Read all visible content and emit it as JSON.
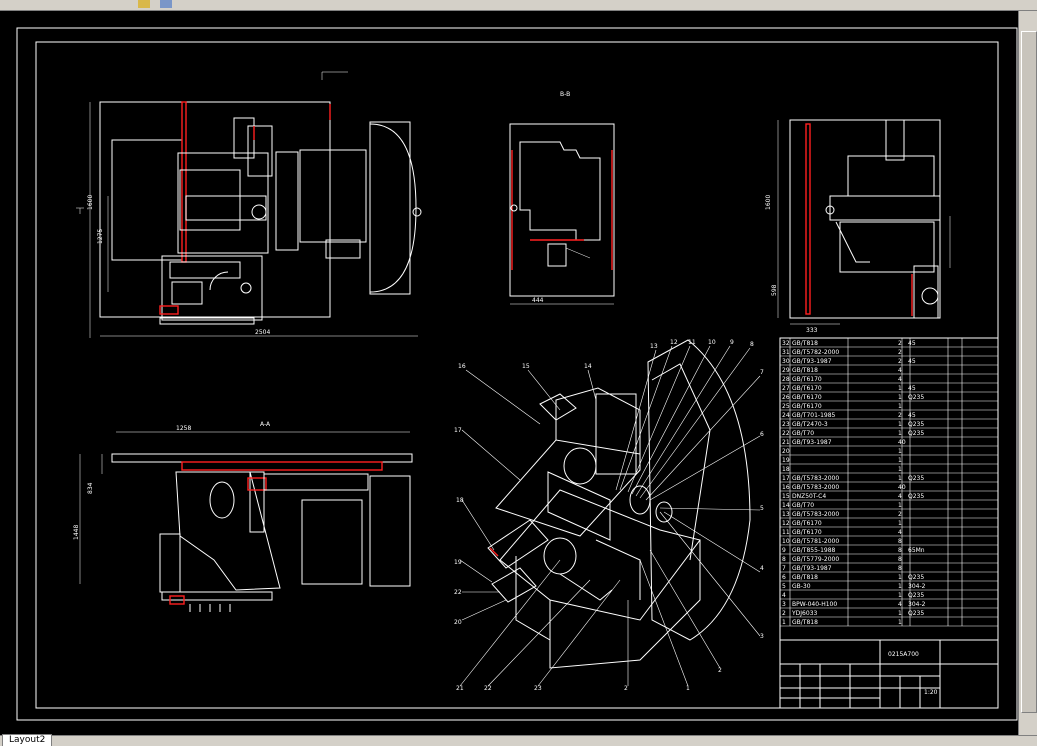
{
  "app": {
    "layout_tab_label": "Layout2"
  },
  "views": {
    "top_dim_width": "2504",
    "top_dim_height": "1600",
    "top_dim_inner": "1275",
    "section_b_label": "B-B",
    "section_b_dim": "444",
    "side_dim_a": "1600",
    "side_dim_b": "598",
    "side_dim_c": "333",
    "section_a_label": "A-A",
    "section_a_dim": "1258",
    "section_a_h1": "1448",
    "section_a_h2": "834"
  },
  "parts_list": {
    "rows": [
      {
        "no": "32",
        "code": "GB/T818",
        "qty": "2",
        "mat": "45"
      },
      {
        "no": "31",
        "code": "GB/T5782-2000",
        "qty": "2",
        "mat": ""
      },
      {
        "no": "30",
        "code": "GB/T93-1987",
        "qty": "2",
        "mat": "45"
      },
      {
        "no": "29",
        "code": "GB/T818",
        "qty": "4",
        "mat": ""
      },
      {
        "no": "28",
        "code": "GB/T6170",
        "qty": "4",
        "mat": ""
      },
      {
        "no": "27",
        "code": "GB/T6170",
        "qty": "1",
        "mat": "45"
      },
      {
        "no": "26",
        "code": "GB/T6170",
        "qty": "1",
        "mat": "Q235"
      },
      {
        "no": "25",
        "code": "GB/T6170",
        "qty": "1",
        "mat": ""
      },
      {
        "no": "24",
        "code": "GB/T701-1985",
        "qty": "2",
        "mat": "45"
      },
      {
        "no": "23",
        "code": "GB/T2470-3",
        "qty": "1",
        "mat": "Q235"
      },
      {
        "no": "22",
        "code": "GB/T70",
        "qty": "1",
        "mat": "Q235"
      },
      {
        "no": "21",
        "code": "GB/T93-1987",
        "qty": "40",
        "mat": ""
      },
      {
        "no": "20",
        "code": "",
        "qty": "1",
        "mat": ""
      },
      {
        "no": "19",
        "code": "",
        "qty": "1",
        "mat": ""
      },
      {
        "no": "18",
        "code": "",
        "qty": "1",
        "mat": ""
      },
      {
        "no": "17",
        "code": "GB/T5783-2000",
        "qty": "1",
        "mat": "Q235"
      },
      {
        "no": "16",
        "code": "GB/T5783-2000",
        "qty": "40",
        "mat": ""
      },
      {
        "no": "15",
        "code": "DNZ50T-C4",
        "qty": "4",
        "mat": "Q235"
      },
      {
        "no": "14",
        "code": "GB/T70",
        "qty": "1",
        "mat": ""
      },
      {
        "no": "13",
        "code": "GB/T5783-2000",
        "qty": "2",
        "mat": ""
      },
      {
        "no": "12",
        "code": "GB/T6170",
        "qty": "1",
        "mat": ""
      },
      {
        "no": "11",
        "code": "GB/T6170",
        "qty": "4",
        "mat": ""
      },
      {
        "no": "10",
        "code": "GB/T5781-2000",
        "qty": "8",
        "mat": ""
      },
      {
        "no": "9",
        "code": "GB/T855-1988",
        "qty": "8",
        "mat": "65Mn"
      },
      {
        "no": "8",
        "code": "GB/T5779-2000",
        "qty": "8",
        "mat": ""
      },
      {
        "no": "7",
        "code": "GB/T93-1987",
        "qty": "8",
        "mat": ""
      },
      {
        "no": "6",
        "code": "GB/T818",
        "qty": "1",
        "mat": "Q235"
      },
      {
        "no": "5",
        "code": "GB-30",
        "qty": "1",
        "mat": "304-2"
      },
      {
        "no": "4",
        "code": "",
        "qty": "1",
        "mat": "Q235"
      },
      {
        "no": "3",
        "code": "BPW-040-H100",
        "qty": "4",
        "mat": "304-2"
      },
      {
        "no": "2",
        "code": "YDJ6033",
        "qty": "1",
        "mat": "Q235"
      },
      {
        "no": "1",
        "code": "GB/T818",
        "qty": "1",
        "mat": ""
      }
    ],
    "title_code": "0215A700",
    "scale": "1:20"
  },
  "colors": {
    "background": "#000000",
    "lines": "#ffffff",
    "highlight": "#ff2020"
  }
}
